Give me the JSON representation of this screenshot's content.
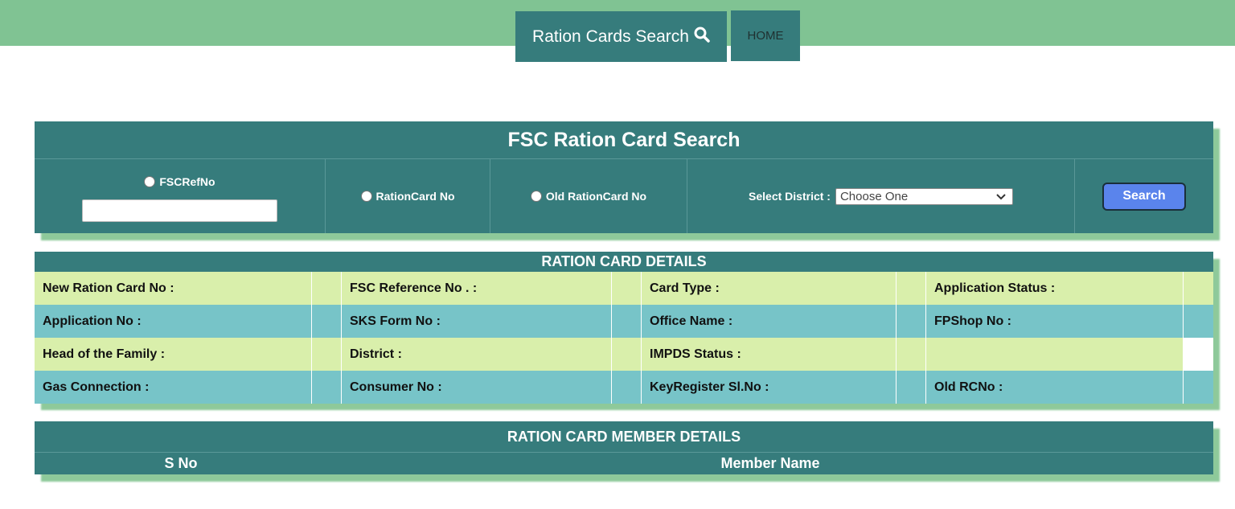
{
  "nav": {
    "search_label": "Ration Cards Search",
    "home_label": "HOME"
  },
  "search_panel": {
    "title": "FSC Ration Card Search",
    "fscrefno_label": "FSCRefNo",
    "fscrefno_value": "",
    "rationcard_label": "RationCard No",
    "old_rationcard_label": "Old RationCard No",
    "district_label": "Select District :",
    "district_selected": "Choose One",
    "search_button": "Search"
  },
  "details": {
    "title": "RATION CARD DETAILS",
    "rows": [
      [
        "New Ration Card No :",
        "FSC Reference No . :",
        "Card Type :",
        "Application Status :"
      ],
      [
        "Application No :",
        "SKS Form No :",
        "Office Name :",
        "FPShop No :"
      ],
      [
        "Head of the Family :",
        "District :",
        "IMPDS Status :",
        ""
      ],
      [
        "Gas Connection :",
        "Consumer No :",
        "KeyRegister Sl.No :",
        "Old RCNo :"
      ]
    ]
  },
  "members": {
    "title": "RATION CARD MEMBER DETAILS",
    "col_sno": "S No",
    "col_name": "Member Name"
  },
  "colors": {
    "band": "#80c393",
    "panel": "#367c7c",
    "row_yellow": "#d9efab",
    "row_cyan": "#77c4c8",
    "button": "#5a84ec"
  }
}
